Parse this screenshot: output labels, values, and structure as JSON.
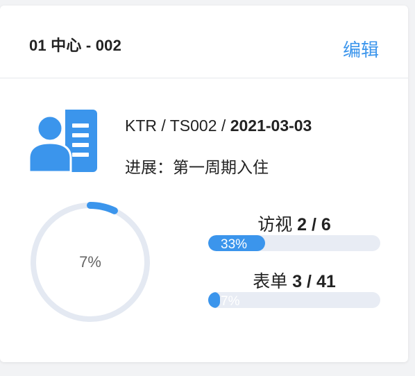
{
  "card": {
    "title": "01 中心 - 002",
    "edit_label": "编辑"
  },
  "profile": {
    "icon": "profile-card-icon",
    "id_prefix": "KTR / TS002 / ",
    "date": "2021-03-03",
    "progress_line": "进展：第一周期入住"
  },
  "overall": {
    "percent": 7,
    "label": "7%"
  },
  "stats": [
    {
      "label": "访视",
      "value": "2 / 6",
      "percent": 33,
      "bar_label": "33%"
    },
    {
      "label": "表单",
      "value": "3 / 41",
      "percent": 7,
      "bar_label": "7%"
    }
  ],
  "colors": {
    "accent": "#3b95ec",
    "track": "#e8ecf4",
    "ring_track": "#e4e9f2"
  }
}
